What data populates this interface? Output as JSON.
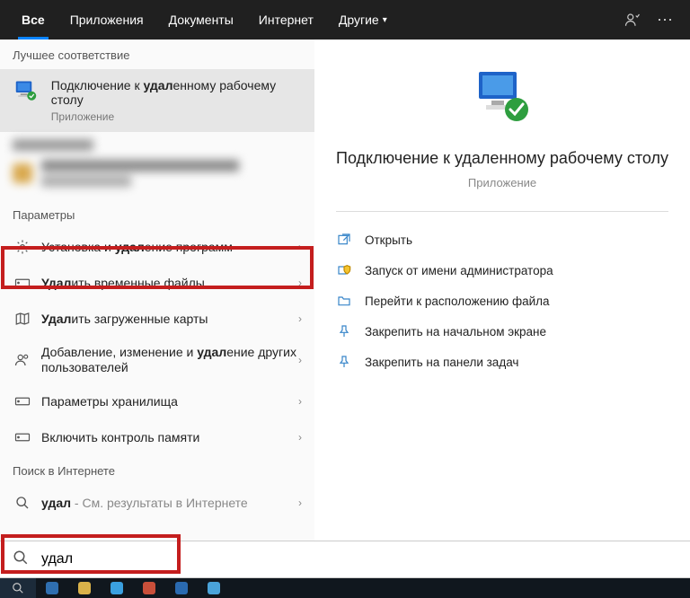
{
  "tabs": {
    "all": "Все",
    "apps": "Приложения",
    "docs": "Документы",
    "web": "Интернет",
    "more": "Другие"
  },
  "left": {
    "best_match_header": "Лучшее соответствие",
    "best": {
      "title_pre": "Подключение к ",
      "title_bold": "удал",
      "title_post": "енному рабочему столу",
      "sub": "Приложение"
    },
    "params_header": "Параметры",
    "params": [
      {
        "pre": "Установка и ",
        "bold": "удал",
        "post": "ение программ"
      },
      {
        "pre": "",
        "bold": "Удал",
        "post": "ить временные файлы"
      },
      {
        "pre": "",
        "bold": "Удал",
        "post": "ить загруженные карты"
      },
      {
        "pre": "Добавление, изменение и ",
        "bold": "удал",
        "post": "ение других пользователей"
      },
      {
        "pre": "Параметры хранилища",
        "bold": "",
        "post": ""
      },
      {
        "pre": "Включить контроль памяти",
        "bold": "",
        "post": ""
      }
    ],
    "web_header": "Поиск в Интернете",
    "web_row": {
      "bold": "удал",
      "hint": " - См. результаты в Интернете"
    }
  },
  "right": {
    "title": "Подключение к удаленному рабочему столу",
    "sub": "Приложение",
    "actions": {
      "open": "Открыть",
      "admin": "Запуск от имени администратора",
      "location": "Перейти к расположению файла",
      "pin_start": "Закрепить на начальном экране",
      "pin_taskbar": "Закрепить на панели задач"
    }
  },
  "search": {
    "value": "удал"
  }
}
